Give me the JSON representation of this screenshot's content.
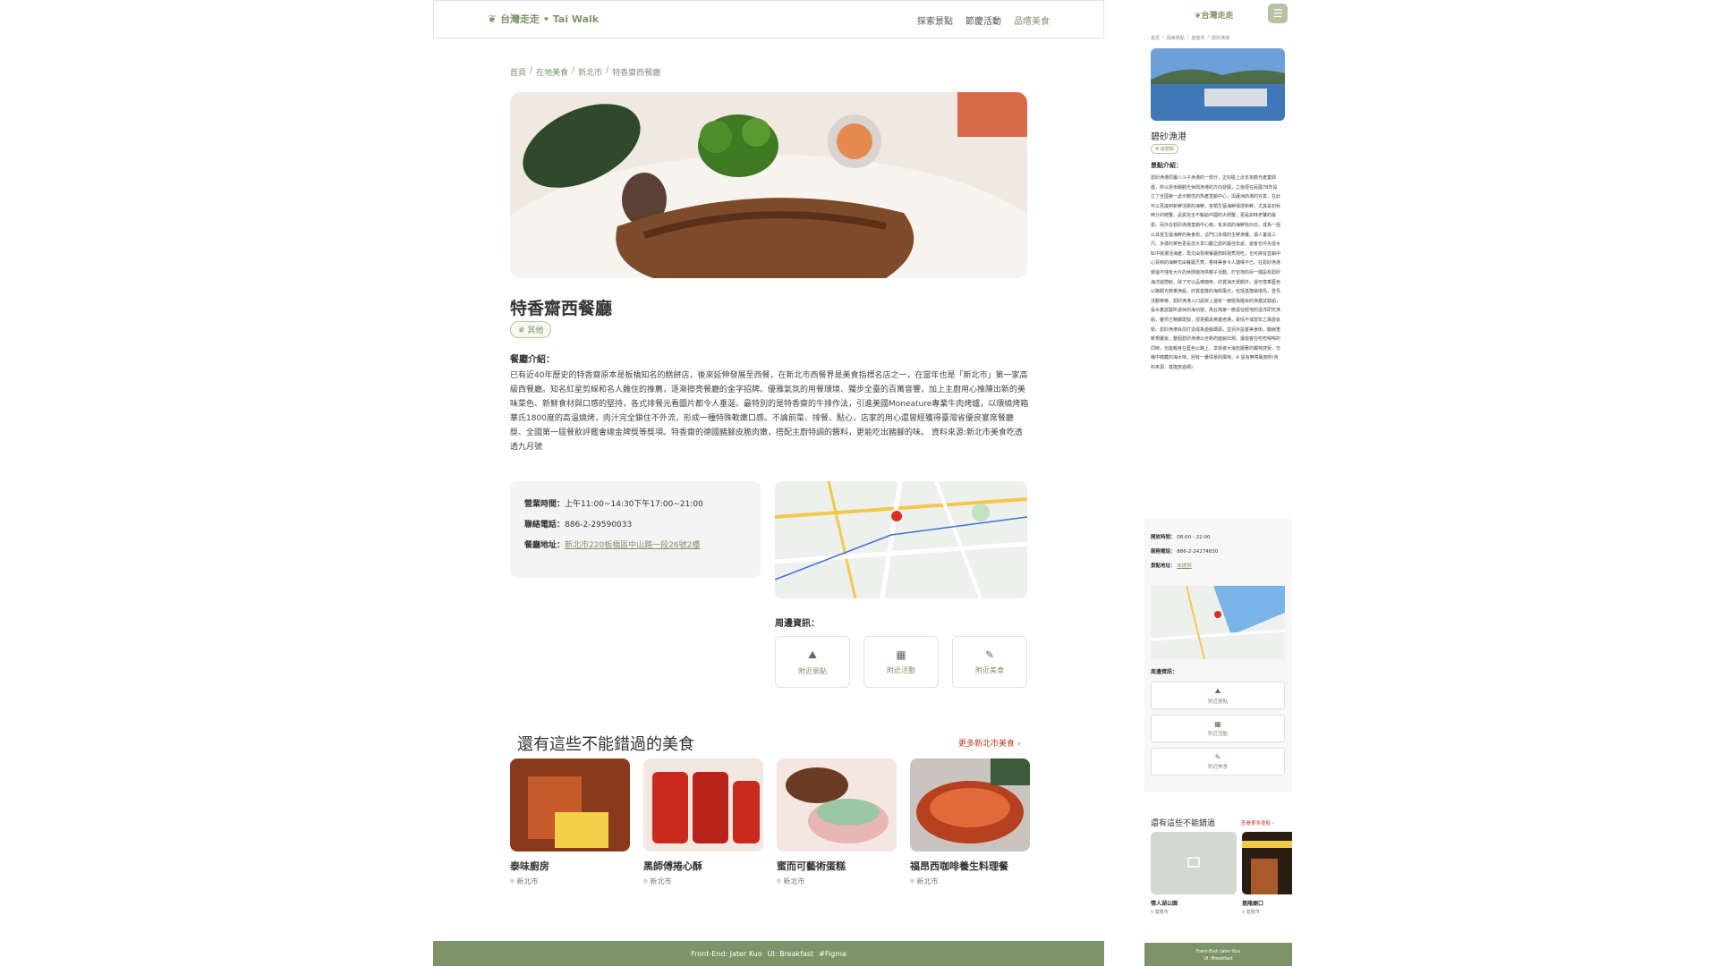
{
  "desktop": {
    "header": {
      "logo": "台灣走走 • Tai Walk",
      "nav": [
        "探索景點",
        "節慶活動",
        "品嚐美食"
      ]
    },
    "breadcrumb": [
      "首頁",
      "在地美食",
      "新北市",
      "特香齋西餐廳"
    ],
    "title": "特香齋西餐廳",
    "tag": "# 其他",
    "intro_heading": "餐廳介紹：",
    "intro_text": "已有近40年歷史的特香齋原本是板橋知名的糕餅店，後來延伸發展至西餐，在新北市西餐界是美食指標名店之一，在當年也是「新北市」第一家高級西餐廳。知名紅星剪綵和名人雜住的推薦，逐漸擦亮餐廳的金字招牌。優雅氣氛的用餐環境、獨步全臺的百萬音響，加上主廚用心推陳出新的美味菜色、新鮮食材與口感的堅持，各式排餐光看圖片都令人垂涎。最特別的是特香齋的牛排作法，引進美國Moneature專業牛肉烤爐，以環繞烤箱華氏1800度的高溫燒烤，肉汁完全鎖住不外流，形成一種特殊軟嫩口感。不論前菜、排餐、點心，店家的用心還曾經獲得臺灣省優良宴席餐廳獎、全國第一屆餐飲評鑑會總金牌獎等獎項。特香齋的德國豬腳皮脆肉嫩，搭配主廚特調的醬料，更能吃出豬腳的味。 資料來源:新北市美食吃透透九月號",
    "info": {
      "hours_label": "營業時間：",
      "hours": "上午11:00~14:30下午17:00~21:00",
      "phone_label": "聯絡電話：",
      "phone": "886-2-29590033",
      "address_label": "餐廳地址：",
      "address": "新北市220板橋區中山路一段26號2樓"
    },
    "nearby": {
      "heading": "周邊資訊：",
      "buttons": [
        {
          "label": "附近景點",
          "icon": "mountain-icon"
        },
        {
          "label": "附近活動",
          "icon": "calendar-icon"
        },
        {
          "label": "附近美食",
          "icon": "food-icon"
        }
      ]
    },
    "more": {
      "heading": "還有這些不能錯過的美食",
      "link": "更多新北市美食",
      "cards": [
        {
          "name": "泰味廚房",
          "location": "新北市"
        },
        {
          "name": "黑師傅捲心酥",
          "location": "新北市"
        },
        {
          "name": "蜜而可藝術蛋糕",
          "location": "新北市"
        },
        {
          "name": "福昂西咖啡養生料理餐",
          "location": "新北市"
        }
      ]
    },
    "footer": [
      "Front-End: Jater Kuo",
      "UI: Breakfast",
      "#Figma"
    ]
  },
  "mobile": {
    "logo": "台灣走走",
    "breadcrumb": [
      "首頁",
      "探索景點",
      "基隆市",
      "碧砂漁港"
    ],
    "title": "碧砂漁港",
    "tag": "# 遊憩類",
    "intro_heading": "景點介紹：",
    "intro_text": "碧砂漁港原屬八斗子漁港的一部分，正好碰上近年來觀光產業興盛，所以逐漸朝觀光休閒漁港的方向發展，之後便在民國78年設立了全國第一處示範性的魚產直銷中心，與蘆洲商港的完善，在此可以見識到新鮮活跳的海鮮，各類生猛海鮮保證新鮮，尤其是初秋時分的螃蟹，品質完全不輸給中國的大閘蟹，更是如味老饕的最愛。另外在碧砂漁港直銷中心旁，有多間的海鮮快炒店，成為一個以尋覓生猛海鮮的美食街，這門口多樣的生鮮漁獲，讓人垂涎三尺。多樣的菜色更是您大享口腹之慾的最佳去處，遊客也可先從水缸中挑選活海產，再交由現場餐廳廚師現煮現吃，也可將從直銷中心買到的海鮮交由餐廳烹煮，香味美食令人讚嘆不已。在碧砂漁港旁邊不僅有大片的休閒綠地供親子活動，於空地的另一端設有碧砂海洋遊憩館，除了可以品嚐咖啡，欣賞海天景觀外，還可搭乘藍色公路觀光族乘漁船，欣賞基隆的海岸風光，包括基隆嶼環島，登島活動等等。碧砂漁港入口處岸上還有一艘極為醒目的漁業試驗船，是水產試驗所退休的海功號，為台灣第一艘遠征極地的遠洋研究漁船，雖然已略顯斑駁，卻更顯其英雄老邁，豪情不減當年之風發氣勢。碧砂漁港目前打造成為遊艇碼頭，並另外設置美食街，動線重新規畫後，整個碧砂漁港以全新的面貌出現，讓遊客在吃吃喝喝的同時，也能親身在藍色公路上，享受被大海包圍著的獨特感受，交織中蘊藏的海水味，別有一番情景的風味。※ 設有無障礙廁所(資料來源：基隆旅遊網)",
    "info": {
      "hours_label": "開放時間：",
      "hours": "08:00 - 22:00",
      "phone_label": "服務電話：",
      "phone": "886-2-24274830",
      "address_label": "景點地址：",
      "address": "未提供"
    },
    "nearby_heading": "周邊資訊：",
    "nearby_buttons": [
      "附近景點",
      "附近活動",
      "附近美食"
    ],
    "more_heading": "還有這些不能錯過",
    "more_link": "查看更多景點",
    "cards": [
      {
        "name": "情人湖公園",
        "location": "基隆市"
      },
      {
        "name": "基隆廟口",
        "location": "基隆市"
      }
    ],
    "footer": [
      "Front-End: Jater Kuo",
      "UI: Breakfast"
    ]
  },
  "colors": {
    "accent": "#7f9368",
    "link_red": "#c0392b",
    "footer": "#7f9368"
  }
}
